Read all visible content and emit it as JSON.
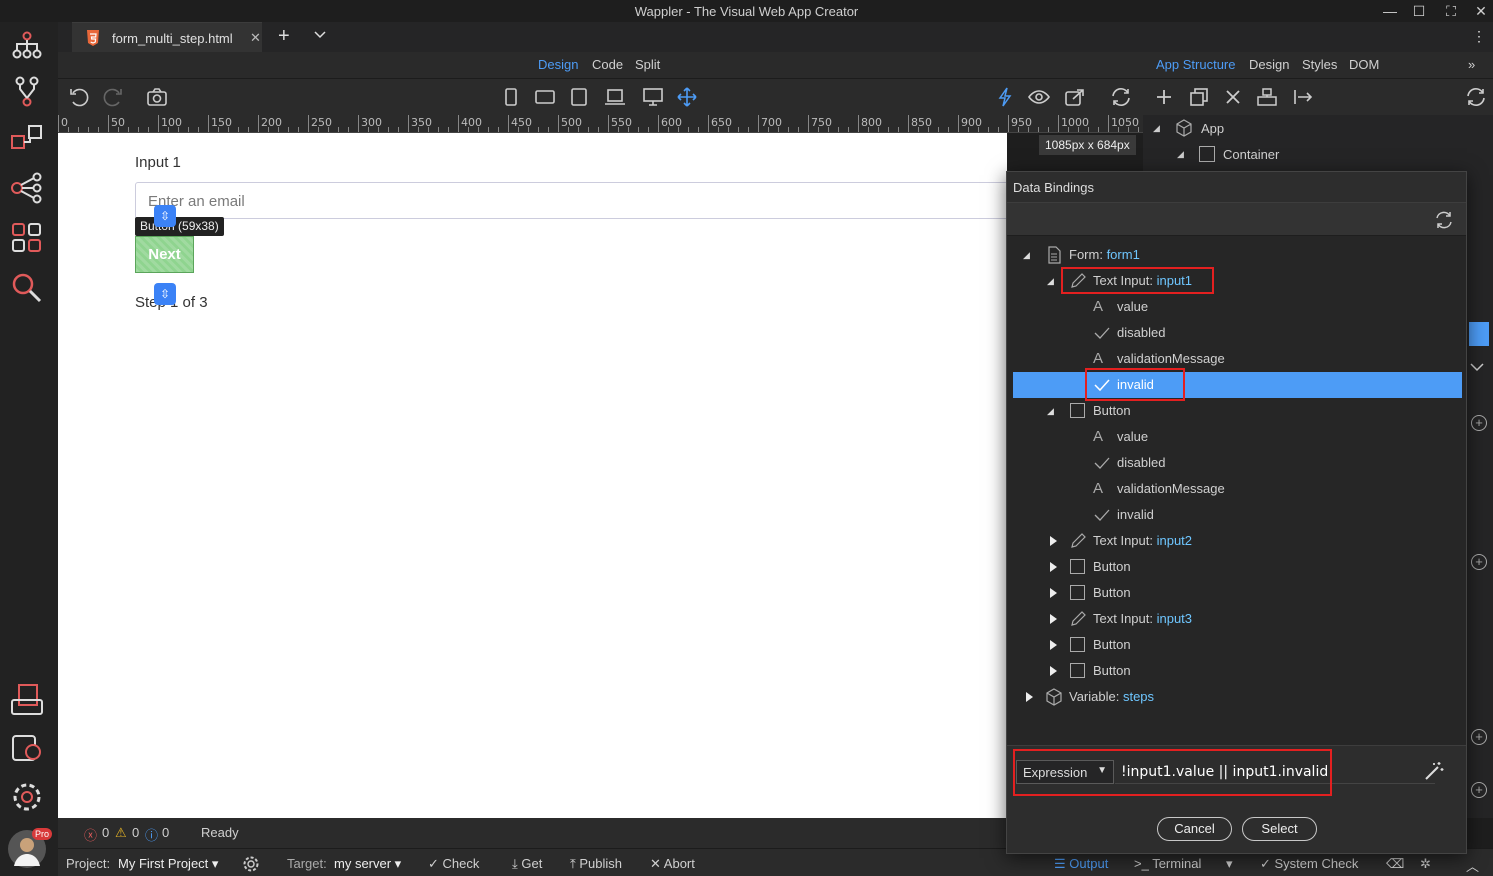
{
  "window": {
    "title": "Wappler - The Visual Web App Creator"
  },
  "tabs": [
    {
      "label": "form_multi_step.html"
    }
  ],
  "view_modes": {
    "design": "Design",
    "code": "Code",
    "split": "Split"
  },
  "right_tabs": {
    "app_structure": "App Structure",
    "design": "Design",
    "styles": "Styles",
    "dom": "DOM"
  },
  "ruler": {
    "ticks": [
      "0",
      "50",
      "100",
      "150",
      "200",
      "250",
      "300",
      "350",
      "400",
      "450",
      "500",
      "550",
      "600",
      "650",
      "700",
      "750",
      "800",
      "850",
      "900",
      "950",
      "1000",
      "1050"
    ]
  },
  "canvas": {
    "size_badge": "1085px x 684px",
    "input_label": "Input 1",
    "input_placeholder": "Enter an email",
    "element_tooltip": "Button (59x38)",
    "next_button": "Next",
    "step_text": "Step 1 of 3"
  },
  "structure": {
    "items": [
      {
        "label": "App"
      },
      {
        "label": "Container"
      }
    ]
  },
  "dialog": {
    "title": "Data Bindings",
    "tree": {
      "form": {
        "prefix": "Form: ",
        "name": "form1"
      },
      "input1": {
        "prefix": "Text Input: ",
        "name": "input1"
      },
      "input1_props": [
        "value",
        "disabled",
        "validationMessage",
        "invalid"
      ],
      "button1": "Button",
      "button1_props": [
        "value",
        "disabled",
        "validationMessage",
        "invalid"
      ],
      "input2": {
        "prefix": "Text Input: ",
        "name": "input2"
      },
      "button2": "Button",
      "button3": "Button",
      "input3": {
        "prefix": "Text Input: ",
        "name": "input3"
      },
      "button4": "Button",
      "button5": "Button",
      "variable": {
        "prefix": "Variable: ",
        "name": "steps"
      }
    },
    "expression_mode": "Expression",
    "expression": "!input1.value ||  input1.invalid",
    "cancel": "Cancel",
    "select": "Select"
  },
  "status": {
    "errors": "0",
    "warnings": "0",
    "infos": "0",
    "state": "Ready"
  },
  "bottom": {
    "project_label": "Project:",
    "project": "My First Project",
    "target_label": "Target:",
    "target": "my server",
    "check": "Check",
    "get": "Get",
    "publish": "Publish",
    "abort": "Abort",
    "output": "Output",
    "terminal": "Terminal",
    "system_check": "System Check",
    "pro_badge": "Pro"
  },
  "colors": {
    "accent": "#4d9cf6",
    "highlight_box": "#e32020",
    "binding_name": "#6ec6ff"
  }
}
